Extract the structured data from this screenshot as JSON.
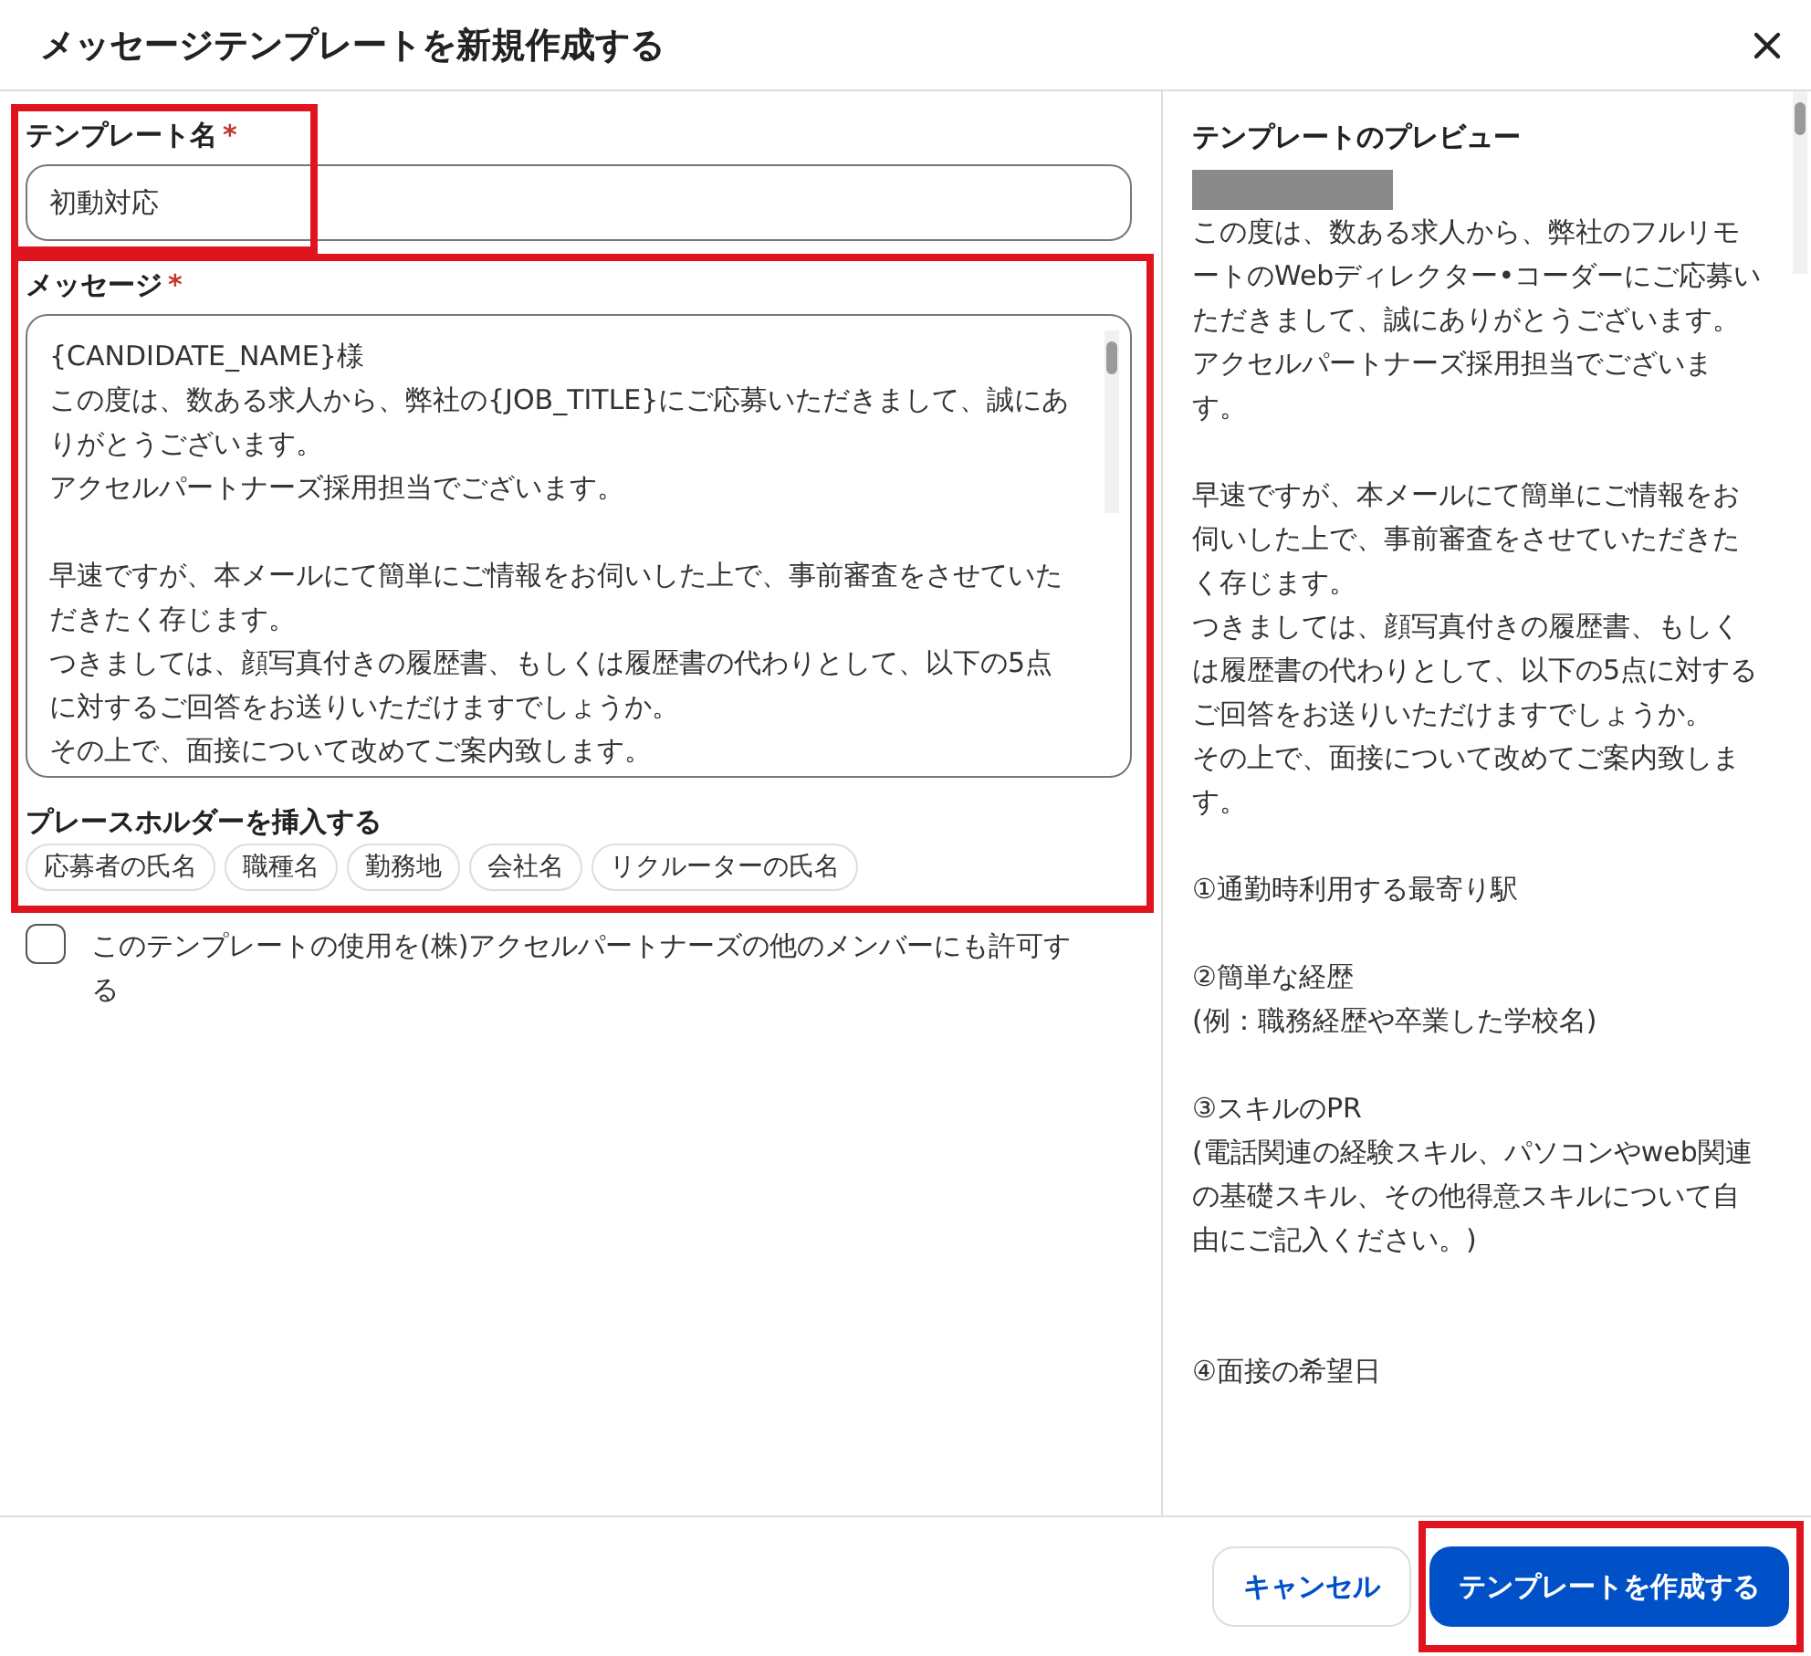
{
  "dialog": {
    "title": "メッセージテンプレートを新規作成する"
  },
  "template_name": {
    "label": "テンプレート名",
    "required_mark": "*",
    "value": "初動対応",
    "highlighted": true
  },
  "message": {
    "label": "メッセージ",
    "required_mark": "*",
    "highlighted": true,
    "blocks": [
      [
        "{CANDIDATE_NAME}様",
        "この度は、数ある求人から、弊社の{JOB_TITLE}にご応募いただきまして、誠にありがとうございます。",
        "アクセルパートナーズ採用担当でございます。"
      ],
      [
        "早速ですが、本メールにて簡単にご情報をお伺いした上で、事前審査をさせていただきたく存じます。",
        "つきましては、顔写真付きの履歴書、もしくは履歴書の代わりとして、以下の5点に対するご回答をお送りいただけますでしょうか。",
        "その上で、面接について改めてご案内致します。"
      ]
    ],
    "placeholders": {
      "label": "プレースホルダーを挿入する",
      "chips": [
        "応募者の氏名",
        "職種名",
        "勤務地",
        "会社名",
        "リクルーターの氏名"
      ]
    }
  },
  "share_checkbox": {
    "label": "このテンプレートの使用を(株)アクセルパートナーズの他のメンバーにも許可する",
    "checked": false
  },
  "preview": {
    "title": "テンプレートのプレビュー",
    "name_redacted": true,
    "blocks": [
      [
        "この度は、数ある求人から、弊社のフルリモートのWebディレクター•コーダーにご応募いただきまして、誠にありがとうございます。",
        "アクセルパートナーズ採用担当でございます。"
      ],
      [
        "早速ですが、本メールにて簡単にご情報をお伺いした上で、事前審査をさせていただきたく存じます。",
        "つきましては、顔写真付きの履歴書、もしくは履歴書の代わりとして、以下の5点に対するご回答をお送りいただけますでしょうか。",
        "その上で、面接について改めてご案内致します。"
      ],
      [
        "①通勤時利用する最寄り駅"
      ],
      [
        "②簡単な経歴",
        "(例：職務経歴や卒業した学校名)"
      ],
      [
        "③スキルのPR",
        "(電話関連の経験スキル、パソコンやweb関連の基礎スキル、その他得意スキルについて自由にご記入ください。)"
      ],
      [
        "④面接の希望日"
      ]
    ]
  },
  "buttons": [
    {
      "label": "キャンセル",
      "kind": "secondary",
      "highlighted": false
    },
    {
      "label": "テンプレートを作成する",
      "kind": "primary",
      "highlighted": true
    }
  ]
}
